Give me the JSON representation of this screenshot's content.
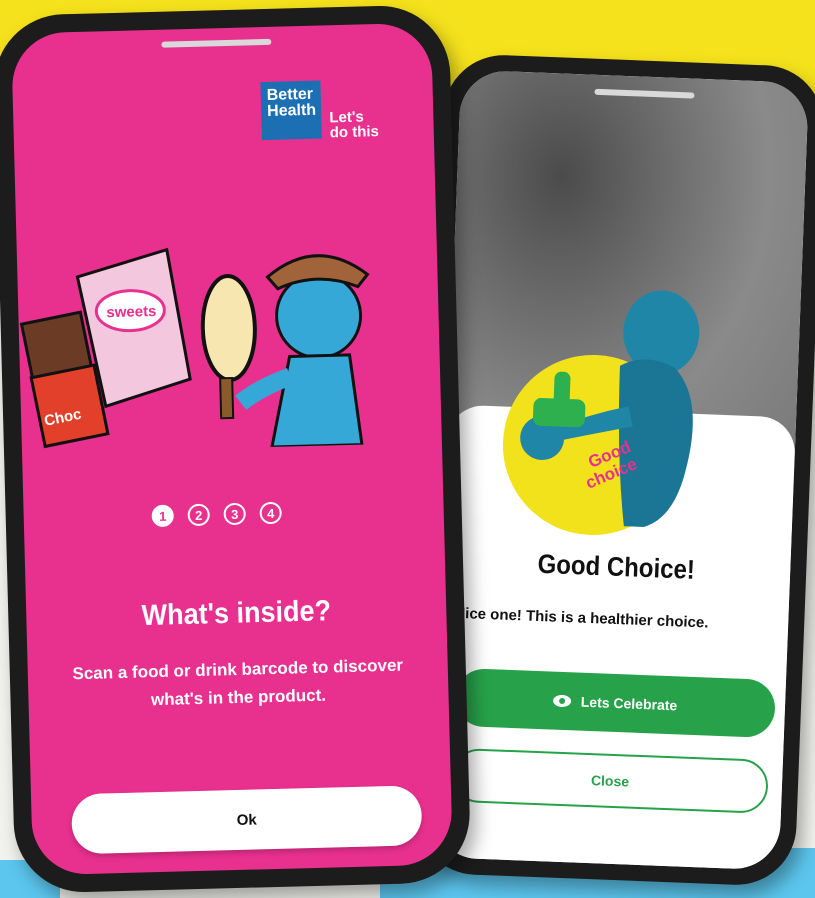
{
  "colors": {
    "pink": "#e8308f",
    "green": "#27a24a",
    "yellow": "#f5e21c",
    "blue": "#1d6fb4"
  },
  "left_phone": {
    "logo": {
      "line1": "Better",
      "line2": "Health",
      "tagline1": "Let's",
      "tagline2": "do this"
    },
    "illustration": {
      "sweets_label": "sweets",
      "choc_label": "Choc"
    },
    "steps": [
      "1",
      "2",
      "3",
      "4"
    ],
    "active_step": 1,
    "title": "What's inside?",
    "body": "Scan a food or drink barcode to discover what's in the product.",
    "ok_label": "Ok"
  },
  "right_phone": {
    "badge_text_line1": "Good",
    "badge_text_line2": "choice",
    "title": "Good Choice!",
    "body": "Nice one! This is a healthier choice.",
    "celebrate_label": "Lets Celebrate",
    "close_label": "Close",
    "celebrate_icon": "eye-icon"
  }
}
